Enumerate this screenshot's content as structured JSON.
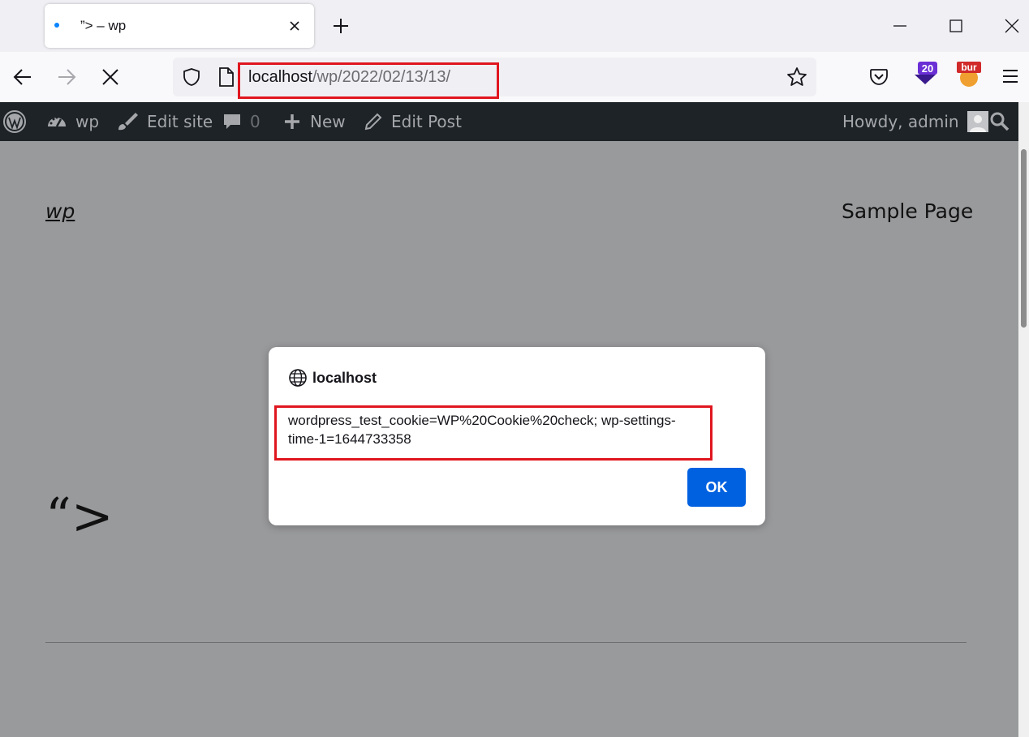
{
  "browser": {
    "tab": {
      "title": "”> – wp"
    },
    "url": {
      "host": "localhost",
      "path": "/wp/2022/02/13/13/"
    },
    "extensions": {
      "badge_count": "20",
      "bur_label": "bur"
    }
  },
  "adminbar": {
    "site_name": "wp",
    "edit_site": "Edit site",
    "comments_count": "0",
    "new": "New",
    "edit_post": "Edit Post",
    "howdy": "Howdy, admin"
  },
  "page": {
    "site_title": "wp",
    "nav_sample_page": "Sample Page",
    "post_title": "“>"
  },
  "dialog": {
    "origin": "localhost",
    "message": "wordpress_test_cookie=WP%20Cookie%20check; wp-settings-time-1=1644733358",
    "ok_label": "OK"
  },
  "colors": {
    "highlight": "#e0161f",
    "ok_button": "#0061e0",
    "adminbar": "#1d2327"
  }
}
